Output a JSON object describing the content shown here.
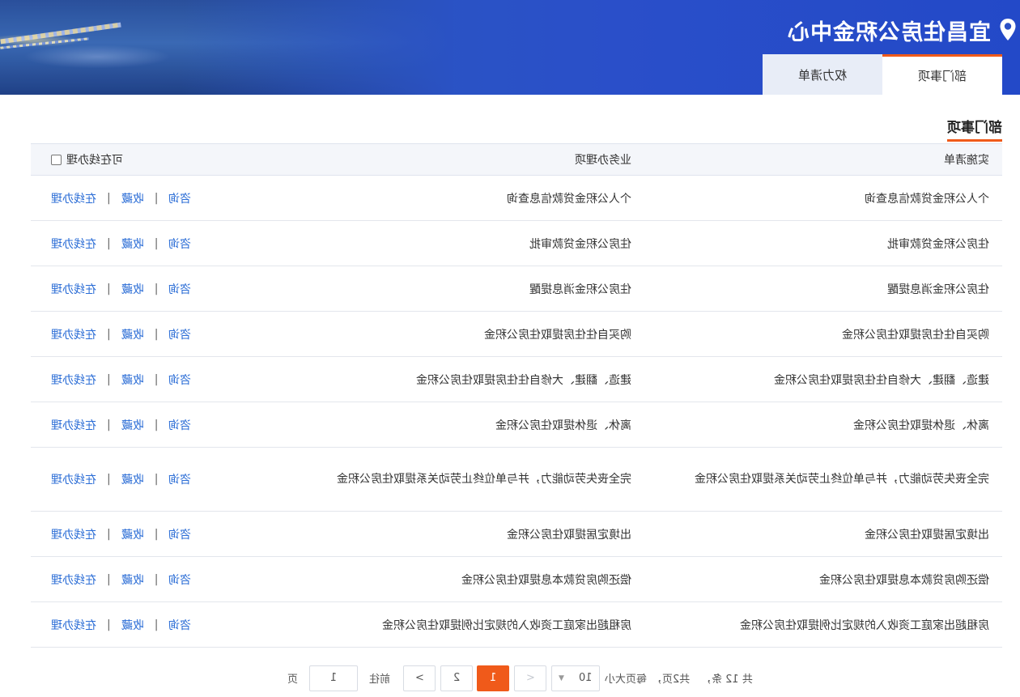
{
  "header": {
    "title": "宜昌住房公积金中心",
    "icon": "location-pin-icon",
    "accent_color": "#2a50c6"
  },
  "tabs": [
    {
      "label": "部门事项",
      "active": true
    },
    {
      "label": "权力清单",
      "active": false
    }
  ],
  "section": {
    "heading": "部门事项",
    "accent_color": "#f05a1a"
  },
  "table": {
    "columns": {
      "impl": "实施清单",
      "biz": "业务办理项",
      "online_filter": "可在线办理"
    },
    "actions": {
      "consult": "咨询",
      "favorite": "收藏",
      "online": "在线办理",
      "separator": "|"
    },
    "rows": [
      {
        "impl": "个人公积金贷款信息查询",
        "biz": "个人公积金贷款信息查询"
      },
      {
        "impl": "住房公积金贷款审批",
        "biz": "住房公积金贷款审批"
      },
      {
        "impl": "住房公积金消息提醒",
        "biz": "住房公积金消息提醒"
      },
      {
        "impl": "购买自住住房提取住房公积金",
        "biz": "购买自住住房提取住房公积金"
      },
      {
        "impl": "建造、翻建、大修自住住房提取住房公积金",
        "biz": "建造、翻建、大修自住住房提取住房公积金"
      },
      {
        "impl": "离休、退休提取住房公积金",
        "biz": "离休、退休提取住房公积金"
      },
      {
        "impl": "完全丧失劳动能力，并与单位终止劳动关系提取住房公积金",
        "biz": "完全丧失劳动能力，并与单位终止劳动关系提取住房公积金"
      },
      {
        "impl": "出境定居提取住房公积金",
        "biz": "出境定居提取住房公积金"
      },
      {
        "impl": "偿还购房贷款本息提取住房公积金",
        "biz": "偿还购房贷款本息提取住房公积金"
      },
      {
        "impl": "房租超出家庭工资收入的规定比例提取住房公积金",
        "biz": "房租超出家庭工资收入的规定比例提取住房公积金"
      }
    ]
  },
  "pagination": {
    "total_text": "共 12 条，",
    "pages_text": "共2页，",
    "page_size_label": "每页大小",
    "page_size": "10",
    "prev": "<",
    "pages": [
      "1",
      "2"
    ],
    "current": "1",
    "next": ">",
    "goto_label": "前往",
    "goto_value": "1",
    "page_unit": "页"
  }
}
